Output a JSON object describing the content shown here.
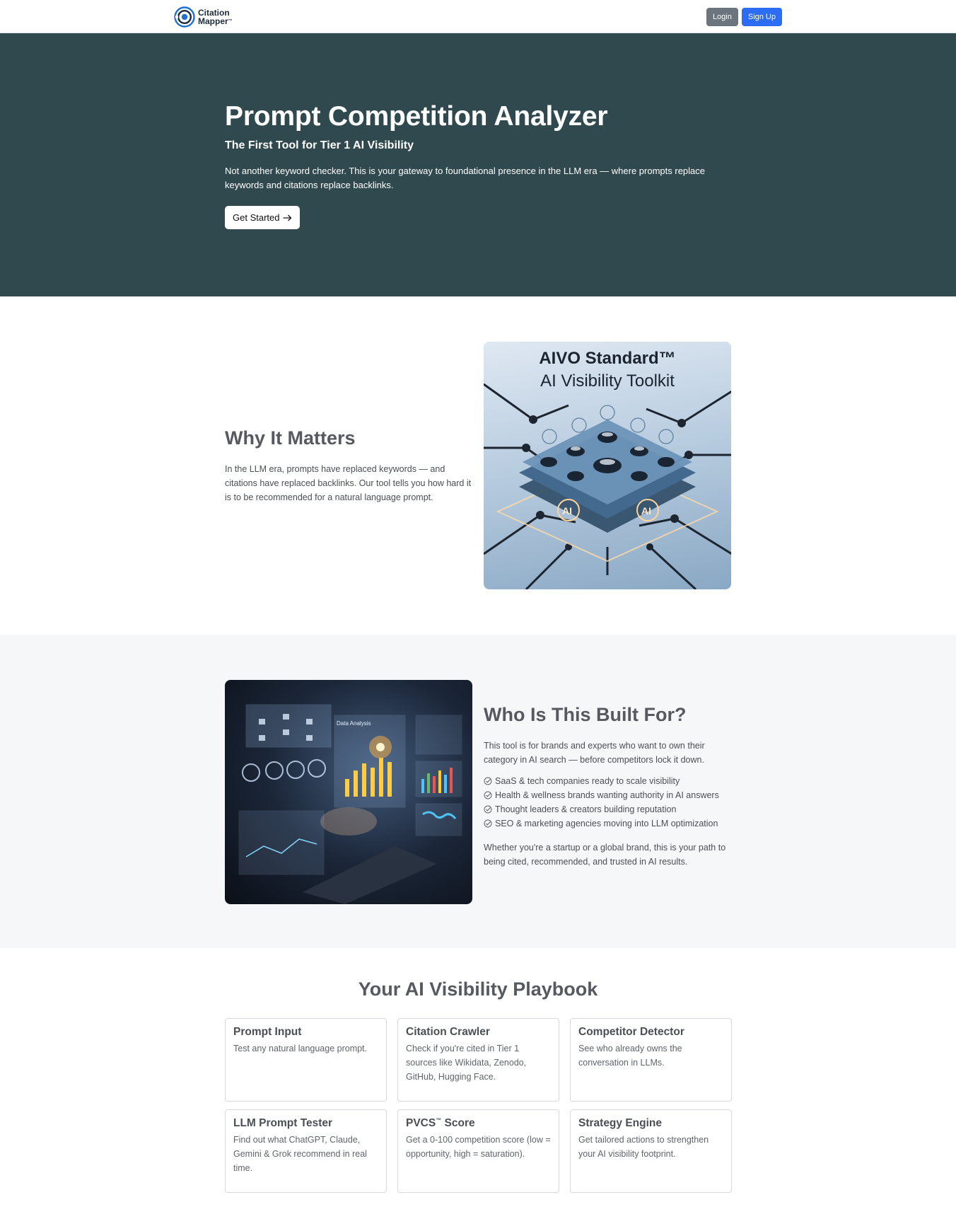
{
  "nav": {
    "logo_line1": "Citation",
    "logo_line2": "Mapper",
    "logo_tm": "™",
    "login_label": "Login",
    "signup_label": "Sign Up"
  },
  "hero": {
    "title": "Prompt Competition Analyzer",
    "subtitle": "The First Tool for Tier 1 AI Visibility",
    "description": "Not another keyword checker. This is your gateway to foundational presence in the LLM era — where prompts replace keywords and citations replace backlinks.",
    "cta_label": "Get Started"
  },
  "why": {
    "heading": "Why It Matters",
    "body": "In the LLM era, prompts have replaced keywords — and citations have replaced backlinks. Our tool tells you how hard it is to be recommended for a natural language prompt.",
    "image_title_line1": "AIVO Standard™",
    "image_title_line2": "AI Visibility Toolkit"
  },
  "who": {
    "heading": "Who Is This Built For?",
    "intro": "This tool is for brands and experts who want to own their category in AI search — before competitors lock it down.",
    "items": [
      "SaaS & tech companies ready to scale visibility",
      "Health & wellness brands wanting authority in AI answers",
      "Thought leaders & creators building reputation",
      "SEO & marketing agencies moving into LLM optimization"
    ],
    "closing": "Whether you're a startup or a global brand, this is your path to being cited, recommended, and trusted in AI results.",
    "image_label": "Data Analysis"
  },
  "playbook": {
    "heading": "Your AI Visibility Playbook",
    "cards": [
      {
        "title": "Prompt Input",
        "sup": "",
        "desc": "Test any natural language prompt."
      },
      {
        "title": "Citation Crawler",
        "sup": "",
        "desc": "Check if you're cited in Tier 1 sources like Wikidata, Zenodo, GitHub, Hugging Face."
      },
      {
        "title": "Competitor Detector",
        "sup": "",
        "desc": "See who already owns the conversation in LLMs."
      },
      {
        "title": "LLM Prompt Tester",
        "sup": "",
        "desc": "Find out what ChatGPT, Claude, Gemini & Grok recommend in real time."
      },
      {
        "title": "PVCS",
        "sup": "™",
        "title_suffix": " Score",
        "desc": "Get a 0-100 competition score (low = opportunity, high = saturation)."
      },
      {
        "title": "Strategy Engine",
        "sup": "",
        "desc": "Get tailored actions to strengthen your AI visibility footprint."
      }
    ]
  },
  "colors": {
    "hero_bg": "#30494f",
    "signup_blue": "#2d6df6",
    "login_gray": "#6c757d",
    "section_alt_bg": "#f6f7f9"
  }
}
